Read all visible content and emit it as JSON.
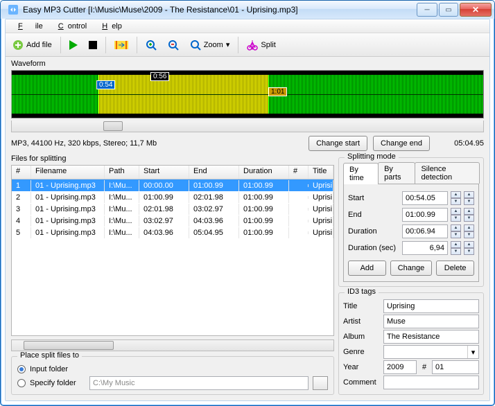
{
  "window": {
    "title": "Easy MP3 Cutter [I:\\Music\\Muse\\2009 - The Resistance\\01 - Uprising.mp3]"
  },
  "menu": {
    "file": "File",
    "control": "Control",
    "help": "Help"
  },
  "toolbar": {
    "add_file": "Add file",
    "zoom": "Zoom",
    "split": "Split"
  },
  "waveform": {
    "label": "Waveform",
    "marker1": "0:54",
    "marker2": "0:56",
    "marker3": "1:01"
  },
  "info": {
    "summary": "MP3, 44100 Hz, 320 kbps, Stereo; 11,7 Mb",
    "change_start": "Change start",
    "change_end": "Change end",
    "total_time": "05:04.95"
  },
  "files": {
    "label": "Files for splitting",
    "headers": {
      "num": "#",
      "filename": "Filename",
      "path": "Path",
      "start": "Start",
      "end": "End",
      "duration": "Duration",
      "num2": "#",
      "title": "Title"
    },
    "rows": [
      {
        "n": "1",
        "fn": "01 - Uprising.mp3",
        "path": "I:\\Mu...",
        "start": "00:00.00",
        "end": "01:00.99",
        "dur": "01:00.99",
        "title": "Uprisi"
      },
      {
        "n": "2",
        "fn": "01 - Uprising.mp3",
        "path": "I:\\Mu...",
        "start": "01:00.99",
        "end": "02:01.98",
        "dur": "01:00.99",
        "title": "Uprisi"
      },
      {
        "n": "3",
        "fn": "01 - Uprising.mp3",
        "path": "I:\\Mu...",
        "start": "02:01.98",
        "end": "03:02.97",
        "dur": "01:00.99",
        "title": "Uprisi"
      },
      {
        "n": "4",
        "fn": "01 - Uprising.mp3",
        "path": "I:\\Mu...",
        "start": "03:02.97",
        "end": "04:03.96",
        "dur": "01:00.99",
        "title": "Uprisi"
      },
      {
        "n": "5",
        "fn": "01 - Uprising.mp3",
        "path": "I:\\Mu...",
        "start": "04:03.96",
        "end": "05:04.95",
        "dur": "01:00.99",
        "title": "Uprisi"
      }
    ]
  },
  "output": {
    "label": "Place split files to",
    "opt_input": "Input folder",
    "opt_specify": "Specify folder",
    "path_placeholder": "C:\\My Music"
  },
  "mode": {
    "label": "Splitting mode",
    "tab_time": "By time",
    "tab_parts": "By parts",
    "tab_silence": "Silence detection",
    "start_lbl": "Start",
    "start_val": "00:54.05",
    "end_lbl": "End",
    "end_val": "01:00.99",
    "dur_lbl": "Duration",
    "dur_val": "00:06.94",
    "dursec_lbl": "Duration (sec)",
    "dursec_val": "6,94",
    "add": "Add",
    "change": "Change",
    "delete": "Delete"
  },
  "id3": {
    "label": "ID3 tags",
    "title_lbl": "Title",
    "title_val": "Uprising",
    "artist_lbl": "Artist",
    "artist_val": "Muse",
    "album_lbl": "Album",
    "album_val": "The Resistance",
    "genre_lbl": "Genre",
    "genre_val": "",
    "year_lbl": "Year",
    "year_val": "2009",
    "num_lbl": "#",
    "num_val": "01",
    "comment_lbl": "Comment",
    "comment_val": ""
  }
}
